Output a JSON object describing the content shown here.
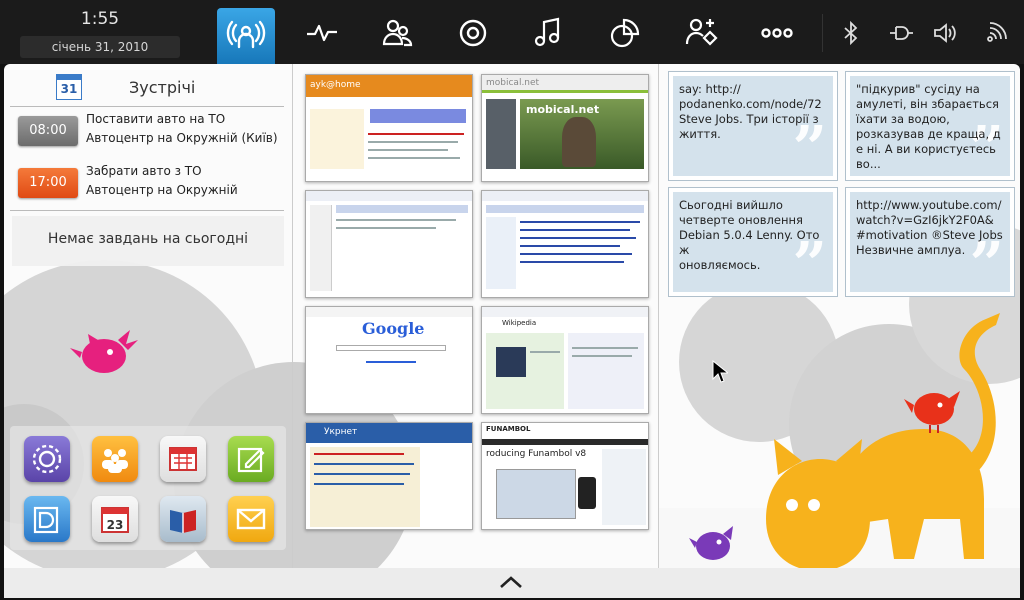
{
  "topbar": {
    "time": "1:55",
    "date": "січень 31, 2010",
    "icons": [
      "myzone-icon",
      "activity-icon",
      "people-icon",
      "media-icon",
      "music-icon",
      "apps-icon",
      "add-contact-icon",
      "zones-icon"
    ],
    "system_icons": [
      "bluetooth-icon",
      "power-icon",
      "volume-icon",
      "wifi-icon"
    ]
  },
  "calendar": {
    "icon_day": "31",
    "title": "Зустрічі",
    "appointments": [
      {
        "time": "08:00",
        "line1": "Поставити авто на ТО",
        "line2": "Автоцентр на Окружній (Київ)",
        "color": "#7b7b7b"
      },
      {
        "time": "17:00",
        "line1": "Забрати авто з ТО",
        "line2": "Автоцентр на Окружній",
        "color": "#e8521e"
      }
    ],
    "no_tasks": "Немає завдань на сьогодні"
  },
  "apps": [
    {
      "name": "settings-app-icon",
      "color": "#6a56b8"
    },
    {
      "name": "people-app-icon",
      "color": "#f4a21e"
    },
    {
      "name": "calendar-app-icon",
      "color": "#d84c4c"
    },
    {
      "name": "notes-app-icon",
      "color": "#8bc63a"
    },
    {
      "name": "documents-app-icon",
      "color": "#3a8fd8"
    },
    {
      "name": "date-app-icon",
      "color": "#d84c4c"
    },
    {
      "name": "book-app-icon",
      "color": "#3a6aa8"
    },
    {
      "name": "email-app-icon",
      "color": "#f2b21e"
    }
  ],
  "thumbs": [
    {
      "text": "ayk@home",
      "color": "#e68a1e"
    },
    {
      "text": "mobical.net",
      "color": "#8bbf3a"
    },
    {
      "text": "",
      "color": "#e8e8f0"
    },
    {
      "text": "",
      "color": "#e8e8f0"
    },
    {
      "text": "Google",
      "color": "#f4f4f4"
    },
    {
      "text": "Wikipedia",
      "color": "#eef2f6"
    },
    {
      "text": "Укрнет",
      "color": "#2a5ea8"
    },
    {
      "text": "FUNAMBOL",
      "color": "#ffffff"
    }
  ],
  "cards": [
    {
      "text": "say: http://\npodanenko.com/node/72\nSteve Jobs. Три історії з\nжиття."
    },
    {
      "text": "\"підкурив\" сусіду на\nамулеті, він збарається\nїхати за водою,\nрозказував де краща, де ні. А ви користуєтесь во..."
    },
    {
      "text": "Сьогодні вийшло\nчетверте оновлення\nDebian 5.0.4 Lenny. Отож\nоновляємось."
    },
    {
      "text": "http://www.youtube.com/\nwatch?v=GzI6jkY2F0A&\n#motivation ®Steve Jobs\nНезвичне амплуа."
    }
  ]
}
